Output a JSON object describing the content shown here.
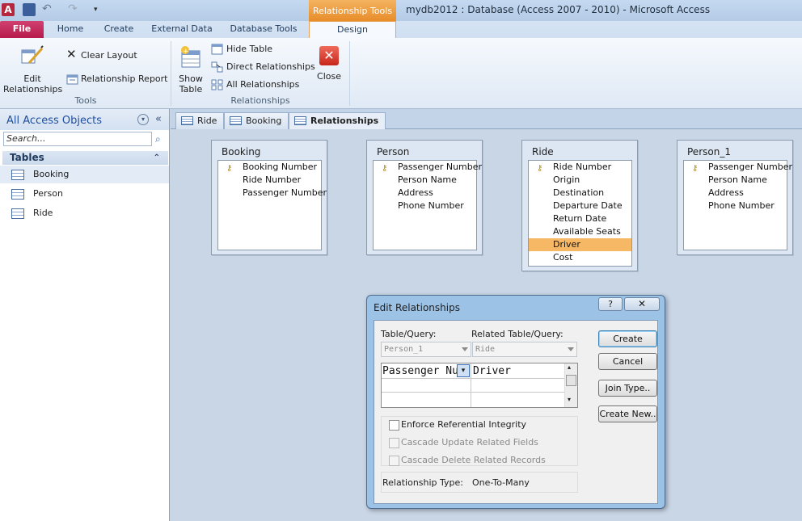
{
  "window": {
    "title": "mydb2012 : Database (Access 2007 - 2010)  -  Microsoft Access",
    "contextual_tab": "Relationship Tools"
  },
  "tabs": [
    "File",
    "Home",
    "Create",
    "External Data",
    "Database Tools",
    "Design"
  ],
  "ribbon": {
    "tools": {
      "edit_relationships": "Edit\nRelationships",
      "edit_l1": "Edit",
      "edit_l2": "Relationships",
      "clear_layout": "Clear Layout",
      "relationship_report": "Relationship Report",
      "group_label": "Tools"
    },
    "relationships": {
      "show_table_l1": "Show",
      "show_table_l2": "Table",
      "hide_table": "Hide Table",
      "direct_relationships": "Direct Relationships",
      "all_relationships": "All Relationships",
      "close": "Close",
      "group_label": "Relationships"
    }
  },
  "nav": {
    "title": "All Access Objects",
    "search_placeholder": "Search...",
    "section": "Tables",
    "items": [
      "Booking",
      "Person",
      "Ride"
    ]
  },
  "doc_tabs": [
    "Ride",
    "Booking",
    "Relationships"
  ],
  "tables": {
    "booking": {
      "title": "Booking",
      "fields": [
        "Booking Number",
        "Ride Number",
        "Passenger Number"
      ]
    },
    "person": {
      "title": "Person",
      "fields": [
        "Passenger Number",
        "Person Name",
        "Address",
        "Phone Number"
      ]
    },
    "ride": {
      "title": "Ride",
      "fields": [
        "Ride Number",
        "Origin",
        "Destination",
        "Departure Date",
        "Return Date",
        "Available Seats",
        "Driver",
        "Cost"
      ]
    },
    "person_1": {
      "title": "Person_1",
      "fields": [
        "Passenger Number",
        "Person Name",
        "Address",
        "Phone Number"
      ]
    }
  },
  "dialog": {
    "title": "Edit Relationships",
    "help": "?",
    "table_query_label": "Table/Query:",
    "related_label": "Related Table/Query:",
    "table_query_value": "Person_1",
    "related_value": "Ride",
    "left_field": "Passenger Nu",
    "right_field": "Driver",
    "buttons": {
      "create": "Create",
      "cancel": "Cancel",
      "join_type": "Join Type..",
      "create_new": "Create New.."
    },
    "enforce": "Enforce Referential Integrity",
    "cascade_update": "Cascade Update Related Fields",
    "cascade_delete": "Cascade Delete Related Records",
    "relationship_type_label": "Relationship Type:",
    "relationship_type_value": "One-To-Many"
  }
}
